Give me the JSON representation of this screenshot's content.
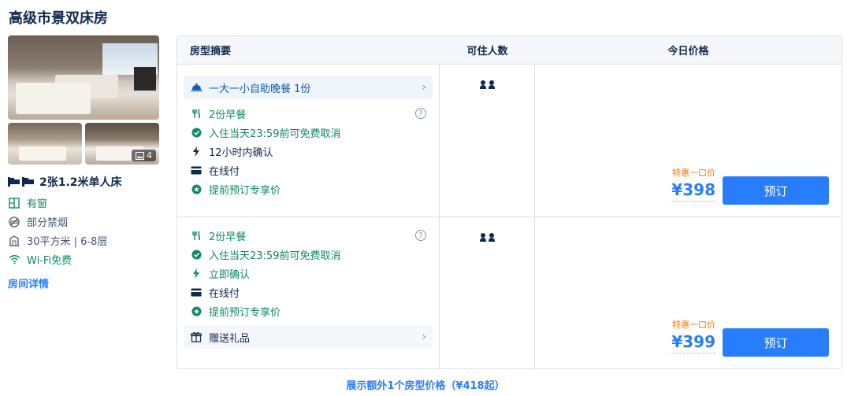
{
  "room_title": "高级市景双床房",
  "photos": {
    "extra_count": "4"
  },
  "room_info": {
    "bed": "2张1.2米单人床",
    "facilities": [
      {
        "label": "有窗",
        "icon": "window-icon"
      },
      {
        "label": "部分禁烟",
        "icon": "no-smoking-icon"
      },
      {
        "label": "30平方米 | 6-8层",
        "icon": "area-icon"
      },
      {
        "label": "Wi-Fi免费",
        "icon": "wifi-icon"
      }
    ],
    "detail_link": "房间详情"
  },
  "table": {
    "headers": [
      "房型摘要",
      "可住人数",
      "今日价格"
    ],
    "rows": [
      {
        "meal": "一大一小自助晚餐 1份",
        "policies": [
          "2份早餐",
          "入住当天23:59前可免费取消",
          "12小时内确认",
          "在线付",
          "提前预订专享价"
        ],
        "promo": "特惠一口价",
        "price": "¥398",
        "book_label": "预订"
      },
      {
        "policies": [
          "2份早餐",
          "入住当天23:59前可免费取消",
          "立即确认",
          "在线付",
          "提前预订专享价"
        ],
        "gift": "赠送礼品",
        "promo": "特惠一口价",
        "price": "¥399",
        "book_label": "预订"
      }
    ]
  },
  "more_link": "展示额外1个房型价格（¥418起）",
  "colors": {
    "accent": "#287dfa",
    "green": "#0f8a5f",
    "promo": "#ff7700",
    "text": "#0f294d"
  }
}
